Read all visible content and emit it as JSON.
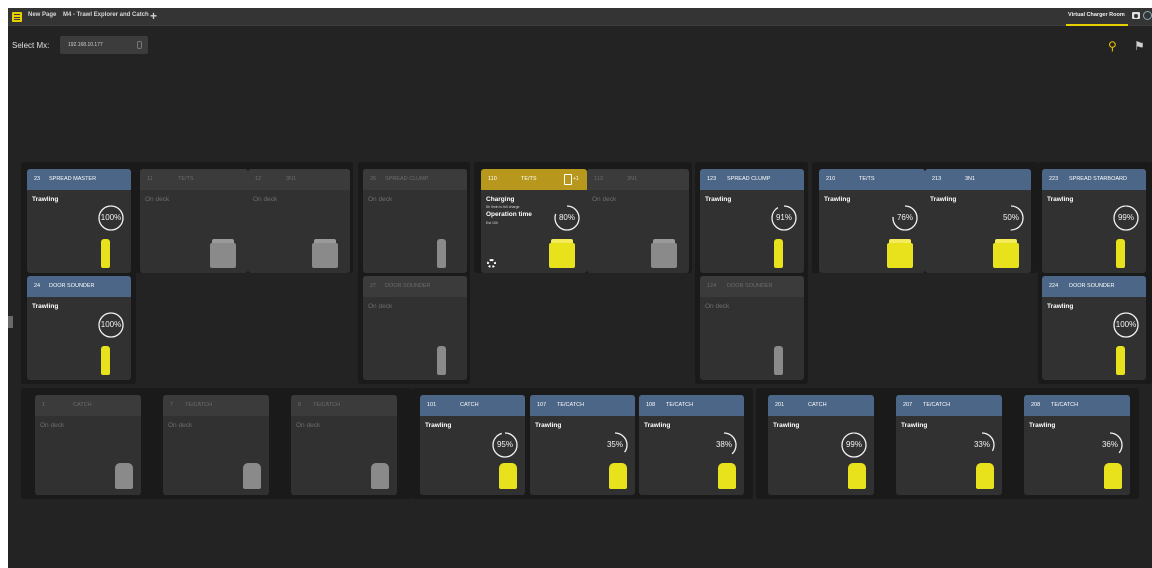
{
  "tabbar": {
    "page_label": "New Page",
    "tab_label": "M4 - Trawl Explorer and Catch",
    "add_label": "+",
    "right_tab_label": "Virtual Charger Room"
  },
  "select": {
    "label": "Select Mx:",
    "value": "192.168.10.177"
  },
  "tools": {
    "wrench": "⚲",
    "pin": "⚑"
  },
  "charging_detail": {
    "sub1": "5h 0min to full charge",
    "op_label": "Operation time",
    "sub2": "Est 10h",
    "batt_label": "+1"
  },
  "cards": [
    {
      "id": "23",
      "type": "SPREAD MASTER",
      "status": "Trawling",
      "pct": "100%",
      "state": "active"
    },
    {
      "id": "11",
      "type": "TE/TS",
      "status": "On deck",
      "state": "inactive"
    },
    {
      "id": "12",
      "type": "3N1",
      "status": "On deck",
      "state": "inactive"
    },
    {
      "id": "26",
      "type": "SPREAD CLUMP",
      "status": "On deck",
      "state": "inactive"
    },
    {
      "id": "110",
      "type": "TE/TS",
      "status": "Charging",
      "pct": "80%",
      "state": "charging"
    },
    {
      "id": "113",
      "type": "3N1",
      "status": "On deck",
      "state": "inactive"
    },
    {
      "id": "123",
      "type": "SPREAD CLUMP",
      "status": "Trawling",
      "pct": "91%",
      "state": "active"
    },
    {
      "id": "210",
      "type": "TE/TS",
      "status": "Trawling",
      "pct": "76%",
      "state": "active"
    },
    {
      "id": "213",
      "type": "3N1",
      "status": "Trawling",
      "pct": "50%",
      "state": "active"
    },
    {
      "id": "223",
      "type": "SPREAD STARBOARD",
      "status": "Trawling",
      "pct": "99%",
      "state": "active"
    },
    {
      "id": "24",
      "type": "DOOR SOUNDER",
      "status": "Trawling",
      "pct": "100%",
      "state": "active"
    },
    {
      "id": "27",
      "type": "DOOR SOUNDER",
      "status": "On deck",
      "state": "inactive"
    },
    {
      "id": "124",
      "type": "DOOR SOUNDER",
      "status": "On deck",
      "state": "inactive"
    },
    {
      "id": "224",
      "type": "DOOR SOUNDER",
      "status": "Trawling",
      "pct": "100%",
      "state": "active"
    },
    {
      "id": "1",
      "type": "CATCH",
      "status": "On deck",
      "state": "inactive"
    },
    {
      "id": "7",
      "type": "TE/CATCH",
      "status": "On deck",
      "state": "inactive"
    },
    {
      "id": "8",
      "type": "TE/CATCH",
      "status": "On deck",
      "state": "inactive"
    },
    {
      "id": "101",
      "type": "CATCH",
      "status": "Trawling",
      "pct": "95%",
      "state": "active"
    },
    {
      "id": "107",
      "type": "TE/CATCH",
      "status": "Trawling",
      "pct": "35%",
      "state": "active"
    },
    {
      "id": "108",
      "type": "TE/CATCH",
      "status": "Trawling",
      "pct": "38%",
      "state": "active"
    },
    {
      "id": "201",
      "type": "CATCH",
      "status": "Trawling",
      "pct": "99%",
      "state": "active"
    },
    {
      "id": "207",
      "type": "TE/CATCH",
      "status": "Trawling",
      "pct": "33%",
      "state": "active"
    },
    {
      "id": "208",
      "type": "TE/CATCH",
      "status": "Trawling",
      "pct": "36%",
      "state": "active"
    }
  ],
  "colors": {
    "background": "#232323",
    "header_active": "#4b6686",
    "header_charging": "#b8981c",
    "sensor_yellow": "#e8e21c",
    "sensor_gray": "#8a8a8a"
  }
}
